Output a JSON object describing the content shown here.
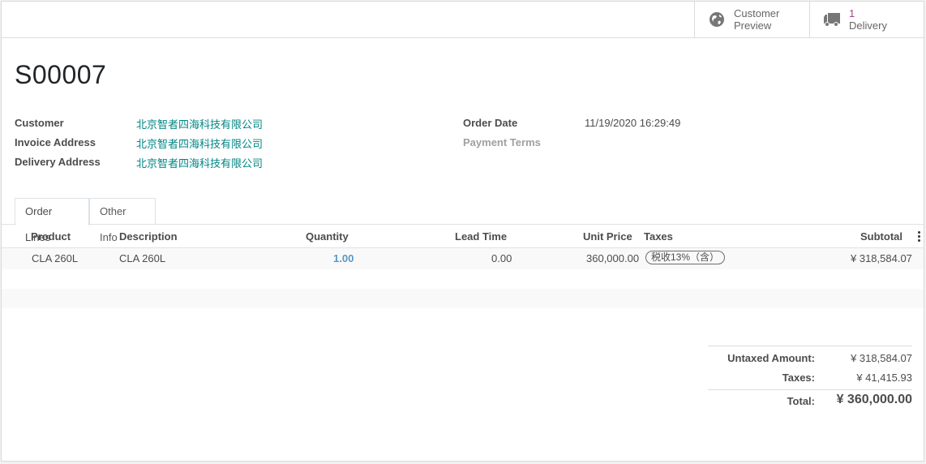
{
  "stat_buttons": [
    {
      "line1": "Customer",
      "line2": "Preview",
      "icon": "globe-icon"
    },
    {
      "count": "1",
      "line2": "Delivery",
      "icon": "truck-icon"
    }
  ],
  "order": {
    "name": "S00007",
    "customer_label": "Customer",
    "customer": "北京智者四海科技有限公司",
    "invoice_address_label": "Invoice Address",
    "invoice_address": "北京智者四海科技有限公司",
    "delivery_address_label": "Delivery Address",
    "delivery_address": "北京智者四海科技有限公司",
    "order_date_label": "Order Date",
    "order_date": "11/19/2020 16:29:49",
    "payment_terms_label": "Payment Terms"
  },
  "tabs": [
    {
      "label": "Order Lines"
    },
    {
      "label": "Other Info"
    }
  ],
  "table": {
    "headers": {
      "product": "Product",
      "description": "Description",
      "quantity": "Quantity",
      "lead_time": "Lead Time",
      "unit_price": "Unit Price",
      "taxes": "Taxes",
      "subtotal": "Subtotal"
    },
    "rows": [
      {
        "product": "CLA 260L",
        "description": "CLA 260L",
        "quantity": "1.00",
        "lead_time": "0.00",
        "unit_price": "360,000.00",
        "tax": "税收13%（含）",
        "subtotal": "¥ 318,584.07"
      }
    ]
  },
  "totals": {
    "untaxed_label": "Untaxed Amount:",
    "untaxed": "¥ 318,584.07",
    "taxes_label": "Taxes:",
    "taxes": "¥ 41,415.93",
    "total_label": "Total:",
    "total": "¥ 360,000.00"
  }
}
